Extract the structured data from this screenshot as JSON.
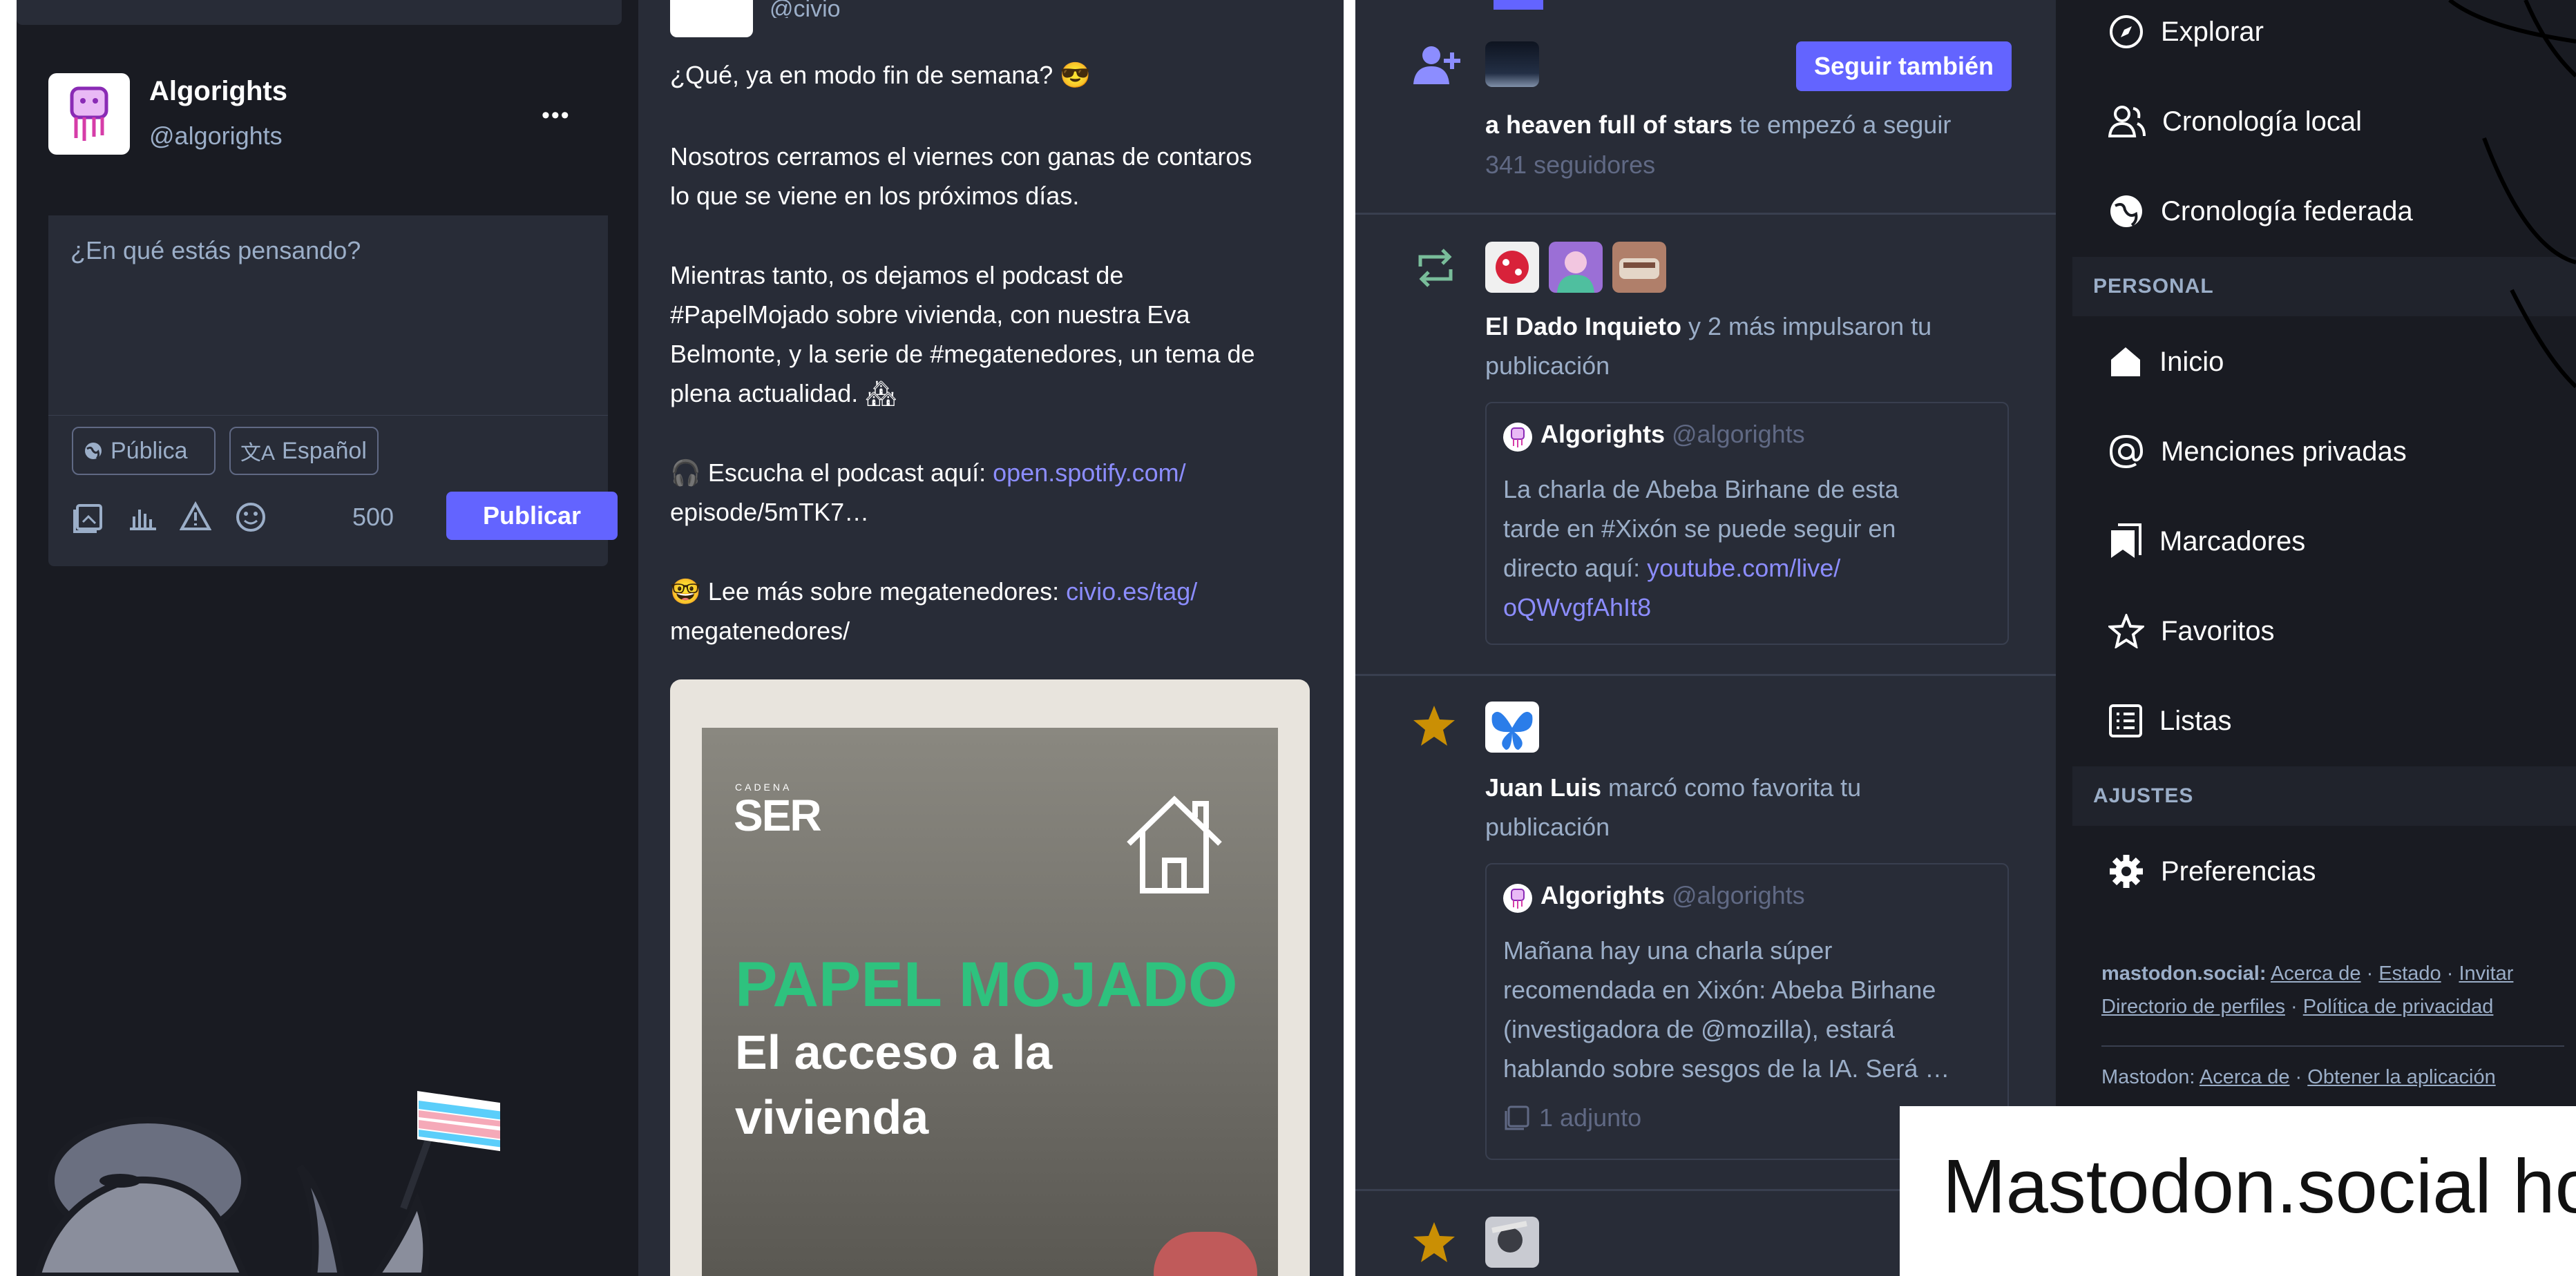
{
  "profile": {
    "name": "Algorights",
    "handle": "@algorights",
    "more": "•••"
  },
  "composer": {
    "placeholder": "¿En qué estás pensando?",
    "visibility": "Pública",
    "language": "Español",
    "char_count": "500",
    "publish": "Publicar"
  },
  "post": {
    "handle_partial": "@civio",
    "p1": "¿Qué, ya en modo fin de semana? 😎",
    "p2a": "Nosotros cerramos el viernes con ganas de contaros",
    "p2b": "lo que se viene en los próximos días.",
    "p3a": "Mientras tanto, os dejamos el podcast de",
    "p3b": "#PapelMojado sobre vivienda, con nuestra Eva",
    "p3c": "Belmonte, y la serie de #megatenedores, un tema de",
    "p3d": "plena actualidad. 🏘",
    "p4_icon": "🎧",
    "p4_text": "Escucha el podcast aquí:",
    "p4_link1": "open.spotify.com/",
    "p4_link2": "episode/5mTK7…",
    "p5_icon": "🤓",
    "p5_text": "Lee más sobre megatenedores:",
    "p5_link1": "civio.es/tag/",
    "p5_link2": "megatenedores/",
    "image": {
      "brand_small": "CADENA",
      "brand": "SER",
      "title": "PAPEL MOJADO",
      "subtitle1": "El acceso a la",
      "subtitle2": "vivienda"
    }
  },
  "notifications": {
    "follow": {
      "button": "Seguir también",
      "name": "a heaven full of stars",
      "action": "te empezó a seguir",
      "followers": "341 seguidores"
    },
    "boost": {
      "name": "El Dado Inquieto",
      "action1": "y 2 más impulsaron tu",
      "action2": "publicación",
      "card": {
        "name": "Algorights",
        "handle": "@algorights",
        "line1": "La charla de Abeba Birhane de esta",
        "line2": "tarde en #Xixón se puede seguir en",
        "line3": "directo aquí:",
        "link1": "youtube.com/live/",
        "link2": "oQWvgfAhIt8"
      }
    },
    "fav": {
      "name": "Juan Luis",
      "action1": "marcó como favorita tu",
      "action2": "publicación",
      "card": {
        "name": "Algorights",
        "handle": "@algorights",
        "line1": "Mañana hay una charla súper",
        "line2": "recomendada en Xixón: Abeba Birhane",
        "line3": "(investigadora de @mozilla),  estará",
        "line4": "hablando sobre sesgos de la IA. Será …",
        "attachment": "1 adjunto"
      }
    }
  },
  "nav": {
    "explore": "Explorar",
    "local": "Cronología local",
    "federated": "Cronología federada",
    "section_personal": "PERSONAL",
    "home": "Inicio",
    "mentions": "Menciones privadas",
    "bookmarks": "Marcadores",
    "favourites": "Favoritos",
    "lists": "Listas",
    "section_settings": "AJUSTES",
    "preferences": "Preferencias"
  },
  "footer": {
    "site": "mastodon.social:",
    "about": "Acerca de",
    "status": "Estado",
    "invite": "Invitar",
    "directory": "Directorio de perfiles",
    "privacy": "Política de privacidad",
    "app": "Mastodon:",
    "about2": "Acerca de",
    "get_app": "Obtener la aplicación",
    "sep": "·"
  },
  "caption": "Mastodon.social ho",
  "colors": {
    "accent": "#6364ff",
    "link": "#8c8dff",
    "boost_green": "#79bd9a",
    "star_gold": "#ca8f04"
  }
}
